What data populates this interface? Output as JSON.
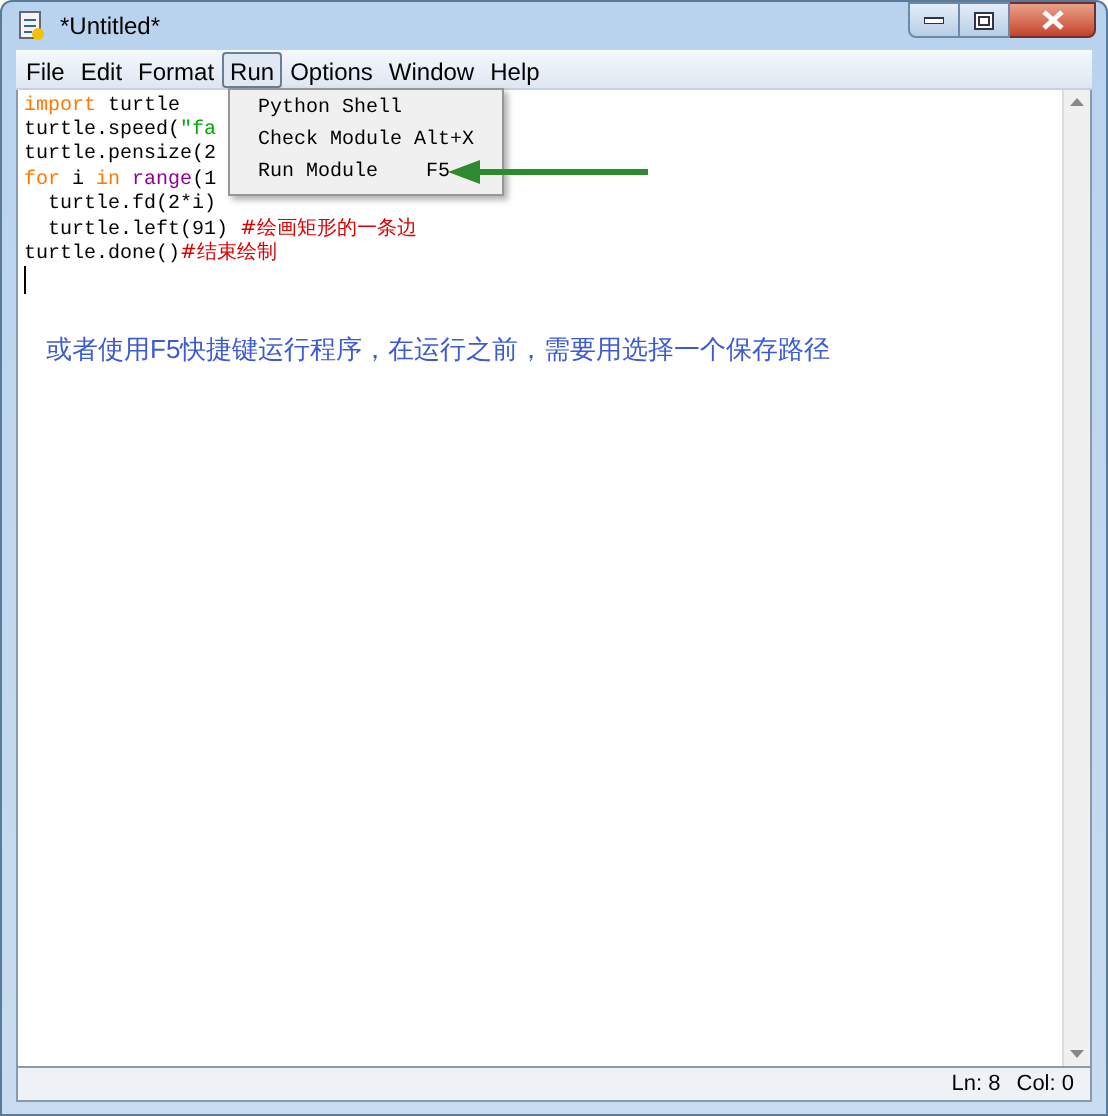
{
  "window": {
    "title": "*Untitled*"
  },
  "menu_bar": [
    {
      "label": "File",
      "selected": false
    },
    {
      "label": "Edit",
      "selected": false
    },
    {
      "label": "Format",
      "selected": false
    },
    {
      "label": "Run",
      "selected": true
    },
    {
      "label": "Options",
      "selected": false
    },
    {
      "label": "Window",
      "selected": false
    },
    {
      "label": "Help",
      "selected": false
    }
  ],
  "editor": {
    "lines": [
      [
        {
          "kind": "keyword",
          "text": "import"
        },
        {
          "kind": "plain",
          "text": " turtle"
        }
      ],
      [
        {
          "kind": "plain",
          "text": "turtle.speed("
        },
        {
          "kind": "string",
          "text": "\"fa"
        }
      ],
      [
        {
          "kind": "plain",
          "text": "turtle.pensize(2"
        }
      ],
      [
        {
          "kind": "keyword",
          "text": "for"
        },
        {
          "kind": "plain",
          "text": " i "
        },
        {
          "kind": "keyword",
          "text": "in"
        },
        {
          "kind": "builtin",
          "text": " range"
        },
        {
          "kind": "plain",
          "text": "(1"
        }
      ],
      [
        {
          "kind": "plain",
          "text": "  turtle.fd(2*i)"
        }
      ],
      [
        {
          "kind": "plain",
          "text": "  turtle.left(91) "
        },
        {
          "kind": "comment",
          "text": "#绘画矩形的一条边"
        }
      ],
      [
        {
          "kind": "plain",
          "text": "turtle.done()"
        },
        {
          "kind": "comment",
          "text": "#结束绘制"
        }
      ]
    ]
  },
  "run_menu": [
    {
      "label": "Python Shell"
    },
    {
      "label": "Check Module",
      "shortcut": "Alt+X"
    },
    {
      "label": "Run Module",
      "shortcut": "F5"
    }
  ],
  "annotation": "或者使用F5快捷键运行程序，在运行之前，需要用选择一个保存路径",
  "status_bar": {
    "line": "Ln: 8",
    "column": "Col: 0"
  }
}
